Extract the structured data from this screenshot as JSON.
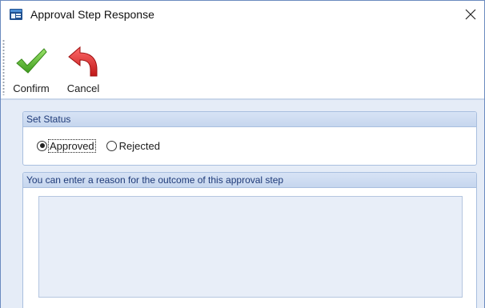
{
  "window": {
    "title": "Approval Step Response",
    "close_icon": "close-icon",
    "app_icon": "app-window-icon"
  },
  "toolbar": {
    "confirm_label": "Confirm",
    "confirm_icon": "checkmark-icon",
    "cancel_label": "Cancel",
    "cancel_icon": "undo-arrow-icon"
  },
  "status_group": {
    "header": "Set Status",
    "options": [
      {
        "label": "Approved",
        "checked": true
      },
      {
        "label": "Rejected",
        "checked": false
      }
    ]
  },
  "reason_group": {
    "header": "You can enter a reason for the outcome of this approval step",
    "value": ""
  },
  "colors": {
    "accent": "#1e3a78",
    "panel_background": "#e5ecf7",
    "confirm_green": "#5cb82e",
    "cancel_red": "#d62727"
  }
}
